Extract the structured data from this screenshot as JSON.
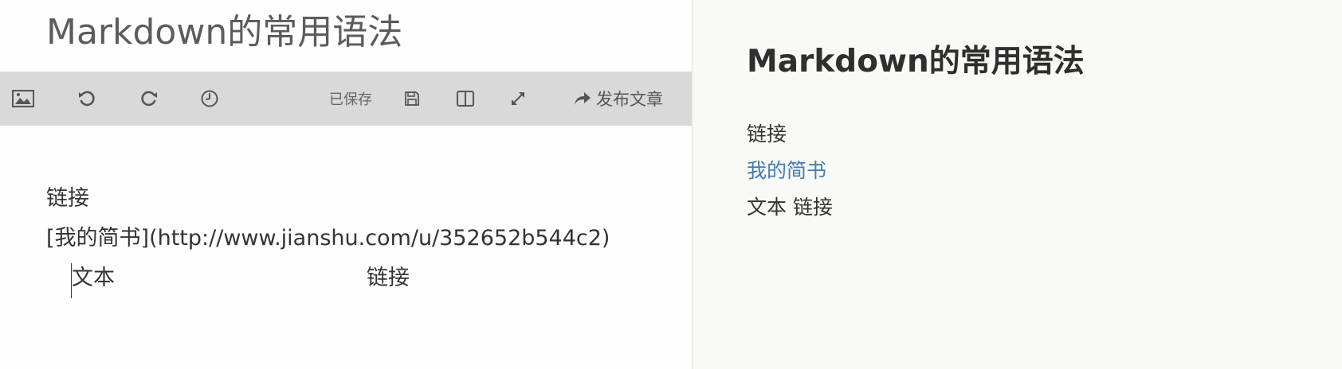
{
  "editor": {
    "title": "Markdown的常用语法",
    "toolbar": {
      "image_icon": "image-icon",
      "undo_icon": "undo-icon",
      "redo_icon": "redo-icon",
      "history_icon": "clock-icon",
      "saved_status": "已保存",
      "save_icon": "save-icon",
      "split_view_icon": "split-view-icon",
      "fullscreen_icon": "fullscreen-icon",
      "publish_icon": "share-arrow-icon",
      "publish_label": "发布文章"
    },
    "lines": [
      "链接",
      "[我的简书](http://www.jianshu.com/u/352652b544c2)"
    ],
    "table_row": {
      "cell_1": "文本",
      "cell_2": "链接"
    }
  },
  "preview": {
    "title": "Markdown的常用语法",
    "paragraph_1": "链接",
    "link_text": "我的简书",
    "paragraph_3": "文本 链接"
  },
  "colors": {
    "toolbar_bg": "#d9d9d9",
    "preview_bg": "#f9f9f5",
    "link": "#3d7eb8",
    "title_gray": "#5c5c5c"
  }
}
